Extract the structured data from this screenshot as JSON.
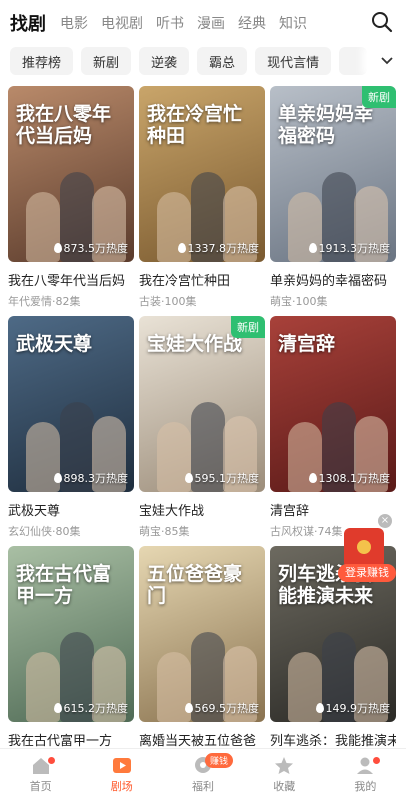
{
  "top_tabs": [
    "找剧",
    "电影",
    "电视剧",
    "听书",
    "漫画",
    "经典",
    "知识"
  ],
  "chips": [
    "推荐榜",
    "新剧",
    "逆袭",
    "霸总",
    "现代言情"
  ],
  "cards": [
    {
      "title": "我在八零年代当后妈",
      "meta": "年代爱情·82集",
      "heat": "873.5万热度",
      "poster_text": "我在八零年代当后妈",
      "badge": "",
      "colors": [
        "#b98a6a",
        "#5a3b2c"
      ]
    },
    {
      "title": "我在冷宫忙种田",
      "meta": "古装·100集",
      "heat": "1337.8万热度",
      "poster_text": "我在冷宫忙种田",
      "badge": "",
      "colors": [
        "#c9a56a",
        "#7a5a30"
      ]
    },
    {
      "title": "单亲妈妈的幸福密码",
      "meta": "萌宝·100集",
      "heat": "1913.3万热度",
      "poster_text": "单亲妈妈幸福密码",
      "badge": "新剧",
      "colors": [
        "#b8bfc8",
        "#6a7482"
      ]
    },
    {
      "title": "武极天尊",
      "meta": "玄幻仙侠·80集",
      "heat": "898.3万热度",
      "poster_text": "武极天尊",
      "badge": "",
      "colors": [
        "#4e6a86",
        "#1f2e3e"
      ]
    },
    {
      "title": "宝娃大作战",
      "meta": "萌宝·85集",
      "heat": "595.1万热度",
      "poster_text": "宝娃大作战",
      "badge": "新剧",
      "colors": [
        "#e9e2d6",
        "#9c8d7a"
      ]
    },
    {
      "title": "清宫辞",
      "meta": "古风权谋·74集",
      "heat": "1308.1万热度",
      "poster_text": "清宫辞",
      "badge": "",
      "colors": [
        "#a8413a",
        "#5a1a18"
      ]
    },
    {
      "title": "我在古代富甲一方",
      "meta": "",
      "heat": "615.2万热度",
      "poster_text": "我在古代富甲一方",
      "badge": "",
      "colors": [
        "#a9bfa4",
        "#4f6a55"
      ]
    },
    {
      "title": "离婚当天被五位爸爸",
      "meta": "",
      "heat": "569.5万热度",
      "poster_text": "五位爸爸豪门",
      "badge": "",
      "colors": [
        "#e6d7b2",
        "#8a7350"
      ]
    },
    {
      "title": "列车逃杀：我能推演未来",
      "meta": "",
      "heat": "149.9万热度",
      "poster_text": "列车逃杀我能推演未来",
      "badge": "",
      "colors": [
        "#6d6a60",
        "#2b2a26"
      ]
    }
  ],
  "promo": {
    "label": "登录赚钱",
    "close": "×"
  },
  "nav": [
    {
      "label": "首页",
      "icon": "home-icon",
      "dot": true,
      "pill": ""
    },
    {
      "label": "剧场",
      "icon": "theater-icon",
      "dot": false,
      "pill": ""
    },
    {
      "label": "福利",
      "icon": "gift-icon",
      "dot": false,
      "pill": "赚钱"
    },
    {
      "label": "收藏",
      "icon": "star-icon",
      "dot": false,
      "pill": ""
    },
    {
      "label": "我的",
      "icon": "profile-icon",
      "dot": true,
      "pill": ""
    }
  ],
  "active_tab": "找剧",
  "active_nav": "剧场",
  "accent": "#ff5a2c",
  "new_badge_color": "#2fbf71"
}
